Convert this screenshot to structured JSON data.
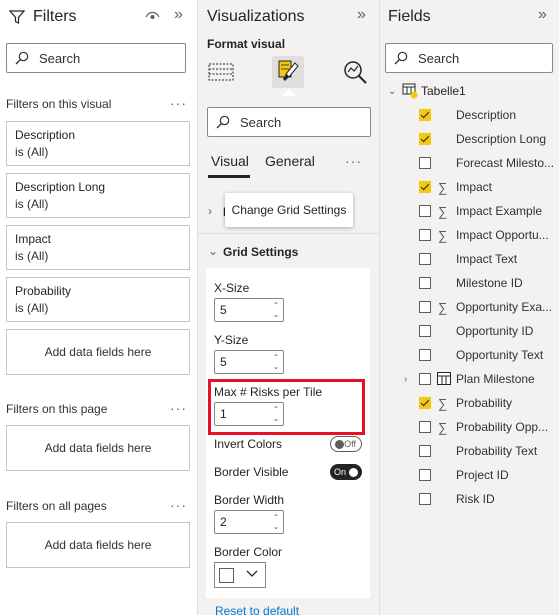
{
  "filters": {
    "title": "Filters",
    "search_placeholder": "Search",
    "on_visual_label": "Filters on this visual",
    "cards": [
      {
        "name": "Description",
        "value": "is (All)"
      },
      {
        "name": "Description Long",
        "value": "is (All)"
      },
      {
        "name": "Impact",
        "value": "is (All)"
      },
      {
        "name": "Probability",
        "value": "is (All)"
      }
    ],
    "add_fields_label": "Add data fields here",
    "on_page_label": "Filters on this page",
    "on_all_pages_label": "Filters on all pages",
    "more_label": "···"
  },
  "viz": {
    "title": "Visualizations",
    "format_visual_label": "Format visual",
    "search_placeholder": "Search",
    "tab_visual": "Visual",
    "tab_general": "General",
    "more_label": "···",
    "tooltip": "Change Grid Settings",
    "grid_section_title": "Grid Settings",
    "x_size_label": "X-Size",
    "x_size_value": "5",
    "y_size_label": "Y-Size",
    "y_size_value": "5",
    "max_risks_label": "Max # Risks per Tile",
    "max_risks_value": "1",
    "invert_colors_label": "Invert Colors",
    "invert_colors_state": "Off",
    "border_visible_label": "Border Visible",
    "border_visible_state": "On",
    "border_width_label": "Border Width",
    "border_width_value": "2",
    "border_color_label": "Border Color",
    "border_color": "#ffffff",
    "reset_label": "Reset to default"
  },
  "fields": {
    "title": "Fields",
    "search_placeholder": "Search",
    "table_name": "Tabelle1",
    "items": [
      {
        "name": "Description",
        "checked": true,
        "sigma": false
      },
      {
        "name": "Description Long",
        "checked": true,
        "sigma": false
      },
      {
        "name": "Forecast Milesto...",
        "checked": false,
        "sigma": false
      },
      {
        "name": "Impact",
        "checked": true,
        "sigma": true
      },
      {
        "name": "Impact Example",
        "checked": false,
        "sigma": true
      },
      {
        "name": "Impact Opportu...",
        "checked": false,
        "sigma": true
      },
      {
        "name": "Impact Text",
        "checked": false,
        "sigma": false
      },
      {
        "name": "Milestone ID",
        "checked": false,
        "sigma": false
      },
      {
        "name": "Opportunity Exa...",
        "checked": false,
        "sigma": true
      },
      {
        "name": "Opportunity ID",
        "checked": false,
        "sigma": false
      },
      {
        "name": "Opportunity Text",
        "checked": false,
        "sigma": false
      },
      {
        "name": "Plan Milestone",
        "checked": false,
        "sigma": false,
        "table": true
      },
      {
        "name": "Probability",
        "checked": true,
        "sigma": true
      },
      {
        "name": "Probability Opp...",
        "checked": false,
        "sigma": true
      },
      {
        "name": "Probability Text",
        "checked": false,
        "sigma": false
      },
      {
        "name": "Project ID",
        "checked": false,
        "sigma": false
      },
      {
        "name": "Risk ID",
        "checked": false,
        "sigma": false
      }
    ]
  },
  "colors": {
    "accent_yellow": "#f2c811",
    "highlight_red": "#e81123",
    "link_blue": "#0078d4"
  }
}
